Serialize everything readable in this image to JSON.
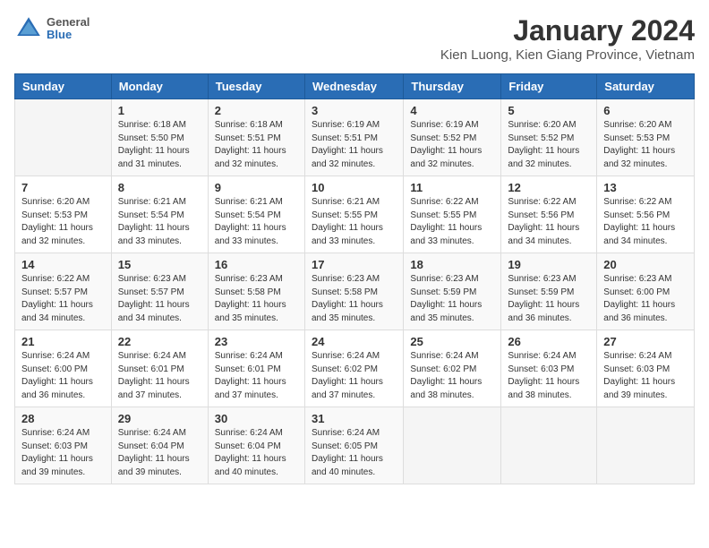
{
  "header": {
    "logo": {
      "general": "General",
      "blue": "Blue"
    },
    "title": "January 2024",
    "location": "Kien Luong, Kien Giang Province, Vietnam"
  },
  "columns": [
    "Sunday",
    "Monday",
    "Tuesday",
    "Wednesday",
    "Thursday",
    "Friday",
    "Saturday"
  ],
  "weeks": [
    [
      {
        "day": "",
        "sunrise": "",
        "sunset": "",
        "daylight": ""
      },
      {
        "day": "1",
        "sunrise": "Sunrise: 6:18 AM",
        "sunset": "Sunset: 5:50 PM",
        "daylight": "Daylight: 11 hours and 31 minutes."
      },
      {
        "day": "2",
        "sunrise": "Sunrise: 6:18 AM",
        "sunset": "Sunset: 5:51 PM",
        "daylight": "Daylight: 11 hours and 32 minutes."
      },
      {
        "day": "3",
        "sunrise": "Sunrise: 6:19 AM",
        "sunset": "Sunset: 5:51 PM",
        "daylight": "Daylight: 11 hours and 32 minutes."
      },
      {
        "day": "4",
        "sunrise": "Sunrise: 6:19 AM",
        "sunset": "Sunset: 5:52 PM",
        "daylight": "Daylight: 11 hours and 32 minutes."
      },
      {
        "day": "5",
        "sunrise": "Sunrise: 6:20 AM",
        "sunset": "Sunset: 5:52 PM",
        "daylight": "Daylight: 11 hours and 32 minutes."
      },
      {
        "day": "6",
        "sunrise": "Sunrise: 6:20 AM",
        "sunset": "Sunset: 5:53 PM",
        "daylight": "Daylight: 11 hours and 32 minutes."
      }
    ],
    [
      {
        "day": "7",
        "sunrise": "Sunrise: 6:20 AM",
        "sunset": "Sunset: 5:53 PM",
        "daylight": "Daylight: 11 hours and 32 minutes."
      },
      {
        "day": "8",
        "sunrise": "Sunrise: 6:21 AM",
        "sunset": "Sunset: 5:54 PM",
        "daylight": "Daylight: 11 hours and 33 minutes."
      },
      {
        "day": "9",
        "sunrise": "Sunrise: 6:21 AM",
        "sunset": "Sunset: 5:54 PM",
        "daylight": "Daylight: 11 hours and 33 minutes."
      },
      {
        "day": "10",
        "sunrise": "Sunrise: 6:21 AM",
        "sunset": "Sunset: 5:55 PM",
        "daylight": "Daylight: 11 hours and 33 minutes."
      },
      {
        "day": "11",
        "sunrise": "Sunrise: 6:22 AM",
        "sunset": "Sunset: 5:55 PM",
        "daylight": "Daylight: 11 hours and 33 minutes."
      },
      {
        "day": "12",
        "sunrise": "Sunrise: 6:22 AM",
        "sunset": "Sunset: 5:56 PM",
        "daylight": "Daylight: 11 hours and 34 minutes."
      },
      {
        "day": "13",
        "sunrise": "Sunrise: 6:22 AM",
        "sunset": "Sunset: 5:56 PM",
        "daylight": "Daylight: 11 hours and 34 minutes."
      }
    ],
    [
      {
        "day": "14",
        "sunrise": "Sunrise: 6:22 AM",
        "sunset": "Sunset: 5:57 PM",
        "daylight": "Daylight: 11 hours and 34 minutes."
      },
      {
        "day": "15",
        "sunrise": "Sunrise: 6:23 AM",
        "sunset": "Sunset: 5:57 PM",
        "daylight": "Daylight: 11 hours and 34 minutes."
      },
      {
        "day": "16",
        "sunrise": "Sunrise: 6:23 AM",
        "sunset": "Sunset: 5:58 PM",
        "daylight": "Daylight: 11 hours and 35 minutes."
      },
      {
        "day": "17",
        "sunrise": "Sunrise: 6:23 AM",
        "sunset": "Sunset: 5:58 PM",
        "daylight": "Daylight: 11 hours and 35 minutes."
      },
      {
        "day": "18",
        "sunrise": "Sunrise: 6:23 AM",
        "sunset": "Sunset: 5:59 PM",
        "daylight": "Daylight: 11 hours and 35 minutes."
      },
      {
        "day": "19",
        "sunrise": "Sunrise: 6:23 AM",
        "sunset": "Sunset: 5:59 PM",
        "daylight": "Daylight: 11 hours and 36 minutes."
      },
      {
        "day": "20",
        "sunrise": "Sunrise: 6:23 AM",
        "sunset": "Sunset: 6:00 PM",
        "daylight": "Daylight: 11 hours and 36 minutes."
      }
    ],
    [
      {
        "day": "21",
        "sunrise": "Sunrise: 6:24 AM",
        "sunset": "Sunset: 6:00 PM",
        "daylight": "Daylight: 11 hours and 36 minutes."
      },
      {
        "day": "22",
        "sunrise": "Sunrise: 6:24 AM",
        "sunset": "Sunset: 6:01 PM",
        "daylight": "Daylight: 11 hours and 37 minutes."
      },
      {
        "day": "23",
        "sunrise": "Sunrise: 6:24 AM",
        "sunset": "Sunset: 6:01 PM",
        "daylight": "Daylight: 11 hours and 37 minutes."
      },
      {
        "day": "24",
        "sunrise": "Sunrise: 6:24 AM",
        "sunset": "Sunset: 6:02 PM",
        "daylight": "Daylight: 11 hours and 37 minutes."
      },
      {
        "day": "25",
        "sunrise": "Sunrise: 6:24 AM",
        "sunset": "Sunset: 6:02 PM",
        "daylight": "Daylight: 11 hours and 38 minutes."
      },
      {
        "day": "26",
        "sunrise": "Sunrise: 6:24 AM",
        "sunset": "Sunset: 6:03 PM",
        "daylight": "Daylight: 11 hours and 38 minutes."
      },
      {
        "day": "27",
        "sunrise": "Sunrise: 6:24 AM",
        "sunset": "Sunset: 6:03 PM",
        "daylight": "Daylight: 11 hours and 39 minutes."
      }
    ],
    [
      {
        "day": "28",
        "sunrise": "Sunrise: 6:24 AM",
        "sunset": "Sunset: 6:03 PM",
        "daylight": "Daylight: 11 hours and 39 minutes."
      },
      {
        "day": "29",
        "sunrise": "Sunrise: 6:24 AM",
        "sunset": "Sunset: 6:04 PM",
        "daylight": "Daylight: 11 hours and 39 minutes."
      },
      {
        "day": "30",
        "sunrise": "Sunrise: 6:24 AM",
        "sunset": "Sunset: 6:04 PM",
        "daylight": "Daylight: 11 hours and 40 minutes."
      },
      {
        "day": "31",
        "sunrise": "Sunrise: 6:24 AM",
        "sunset": "Sunset: 6:05 PM",
        "daylight": "Daylight: 11 hours and 40 minutes."
      },
      {
        "day": "",
        "sunrise": "",
        "sunset": "",
        "daylight": ""
      },
      {
        "day": "",
        "sunrise": "",
        "sunset": "",
        "daylight": ""
      },
      {
        "day": "",
        "sunrise": "",
        "sunset": "",
        "daylight": ""
      }
    ]
  ]
}
